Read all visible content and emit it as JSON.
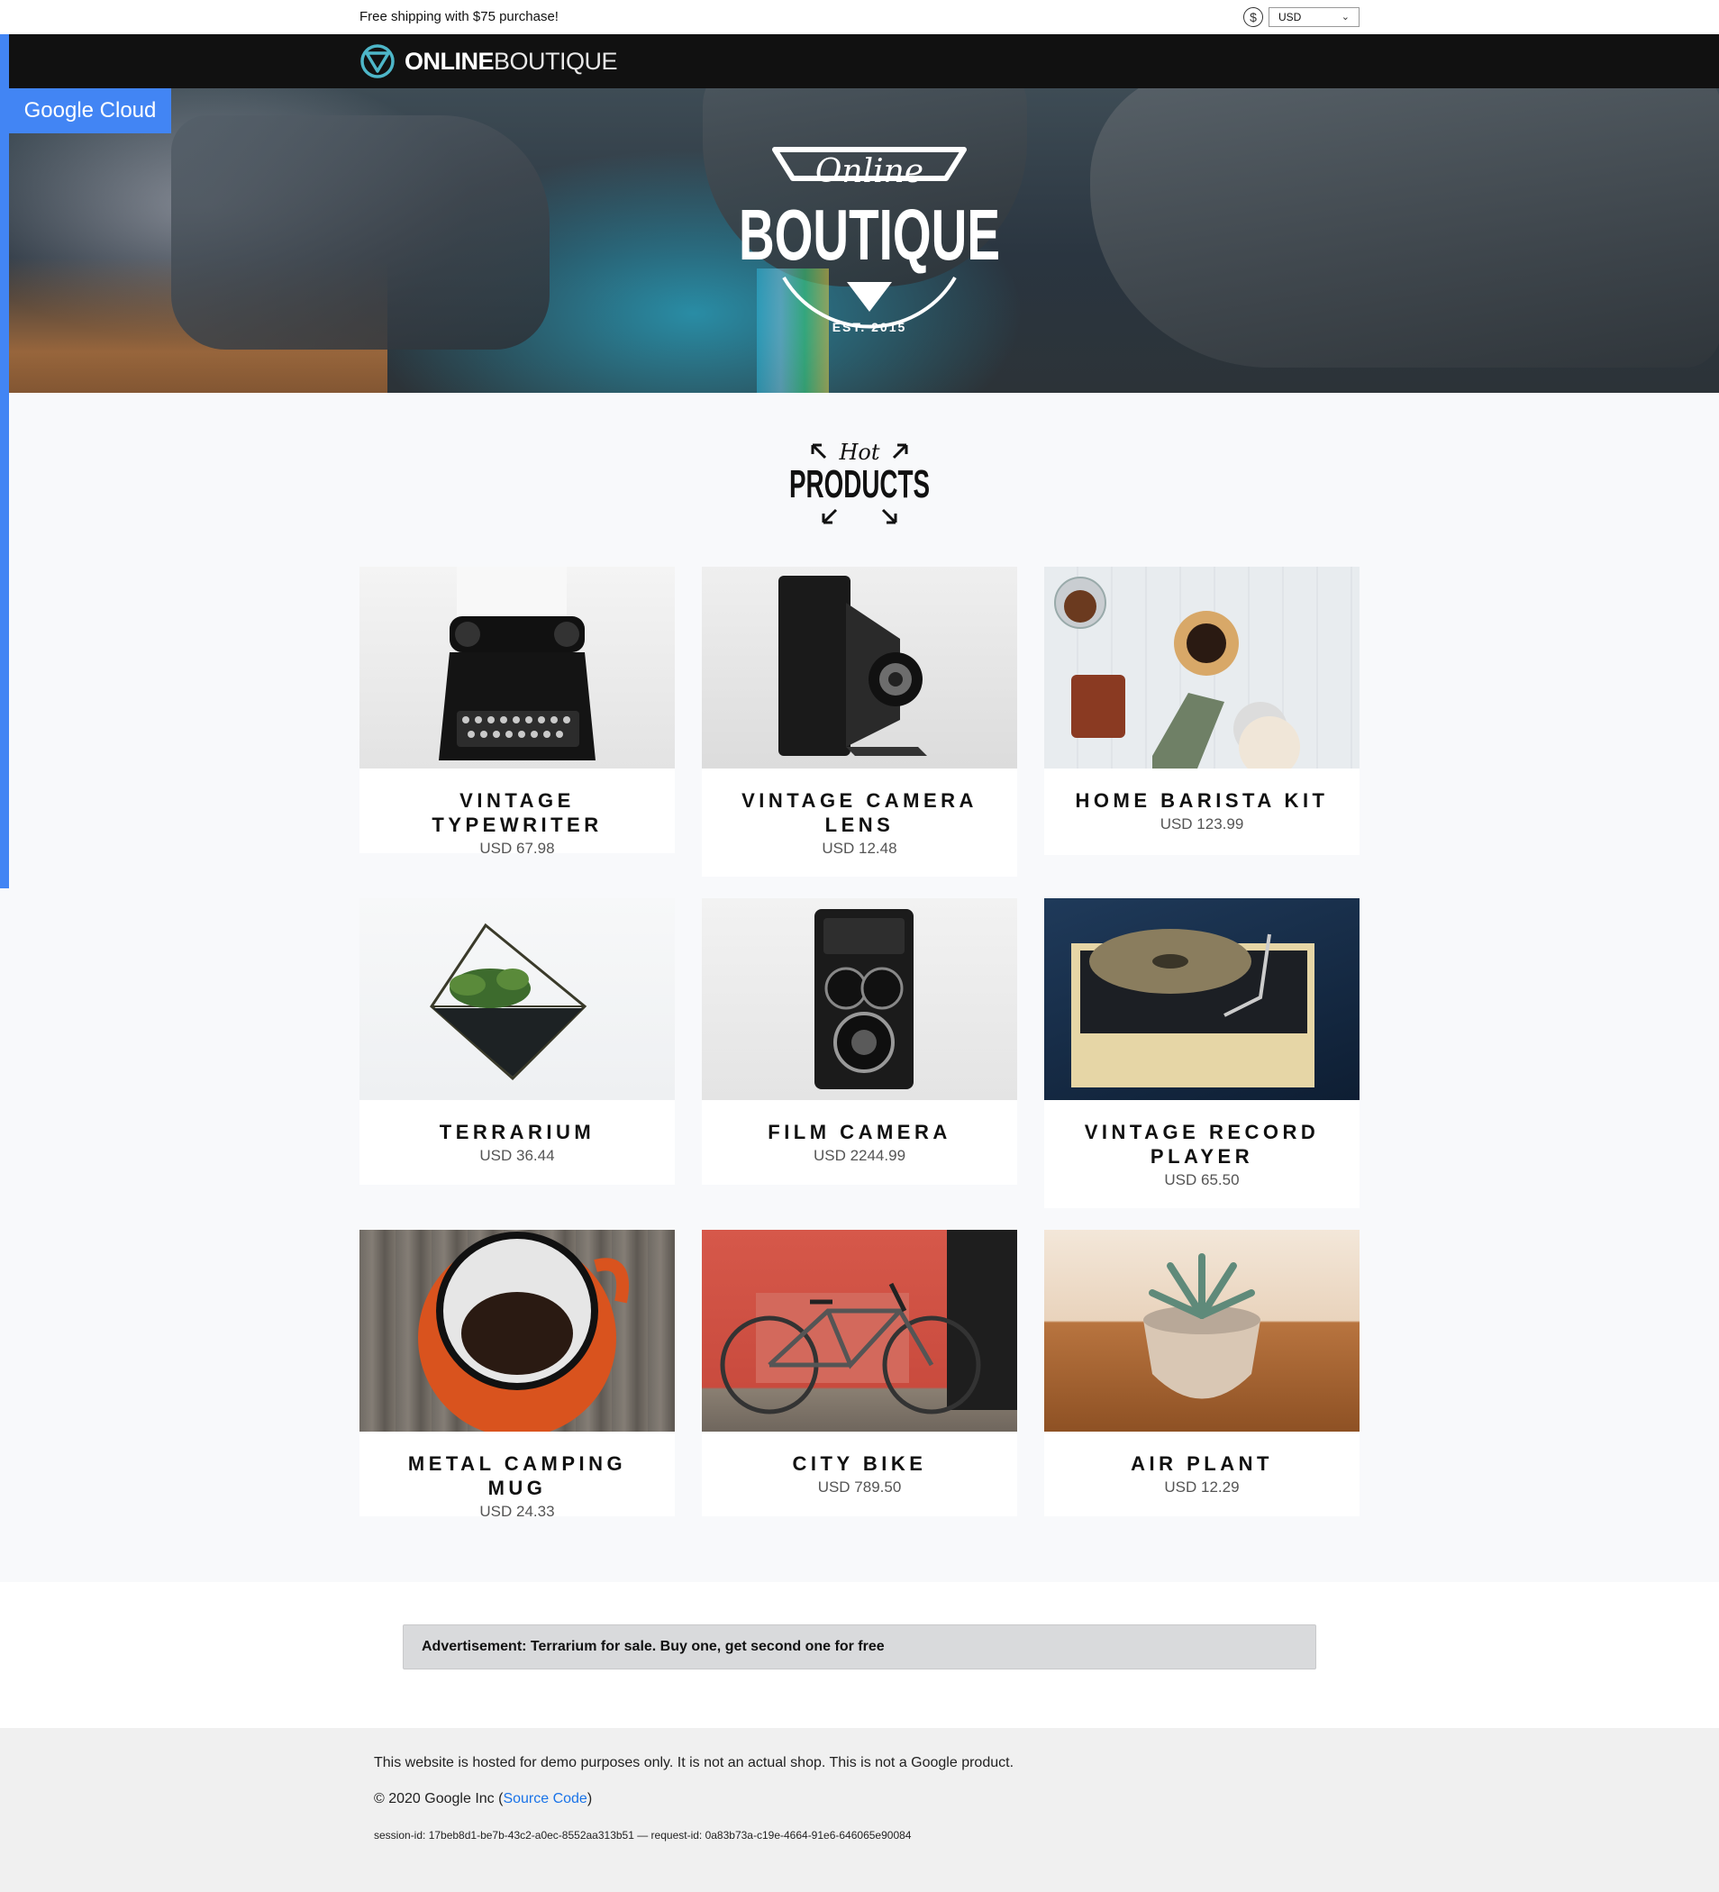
{
  "topbar": {
    "shipping_text": "Free shipping with $75 purchase!",
    "currency_selected": "USD",
    "currency_icon": "dollar-coin-icon"
  },
  "brand": {
    "name_bold": "ONLINE",
    "name_light": "BOUTIQUE",
    "accent_color": "#4db6c8"
  },
  "hero": {
    "logo_script": "Online",
    "logo_main": "BOUTIQUE",
    "logo_est": "EST. 2015"
  },
  "badge": {
    "label": "Google Cloud",
    "color": "#4285f4"
  },
  "hot_products": {
    "script": "Hot",
    "main": "PRODUCTS"
  },
  "products": [
    {
      "name": "Vintage Typewriter",
      "price": "USD 67.98"
    },
    {
      "name": "Vintage Camera Lens",
      "price": "USD 12.48"
    },
    {
      "name": "Home Barista Kit",
      "price": "USD 123.99"
    },
    {
      "name": "Terrarium",
      "price": "USD 36.44"
    },
    {
      "name": "Film Camera",
      "price": "USD 2244.99"
    },
    {
      "name": "Vintage Record Player",
      "price": "USD 65.50"
    },
    {
      "name": "Metal Camping Mug",
      "price": "USD 24.33"
    },
    {
      "name": "City Bike",
      "price": "USD 789.50"
    },
    {
      "name": "Air Plant",
      "price": "USD 12.29"
    }
  ],
  "ad": {
    "text": "Advertisement: Terrarium for sale. Buy one, get second one for free"
  },
  "footer": {
    "disclaimer": "This website is hosted for demo purposes only. It is not an actual shop. This is not a Google product.",
    "copyright_prefix": "© 2020 Google Inc (",
    "source_link": "Source Code",
    "copyright_suffix": ")",
    "session": "session-id: 17beb8d1-be7b-43c2-a0ec-8552aa313b51 — request-id: 0a83b73a-c19e-4664-91e6-646065e90084"
  }
}
